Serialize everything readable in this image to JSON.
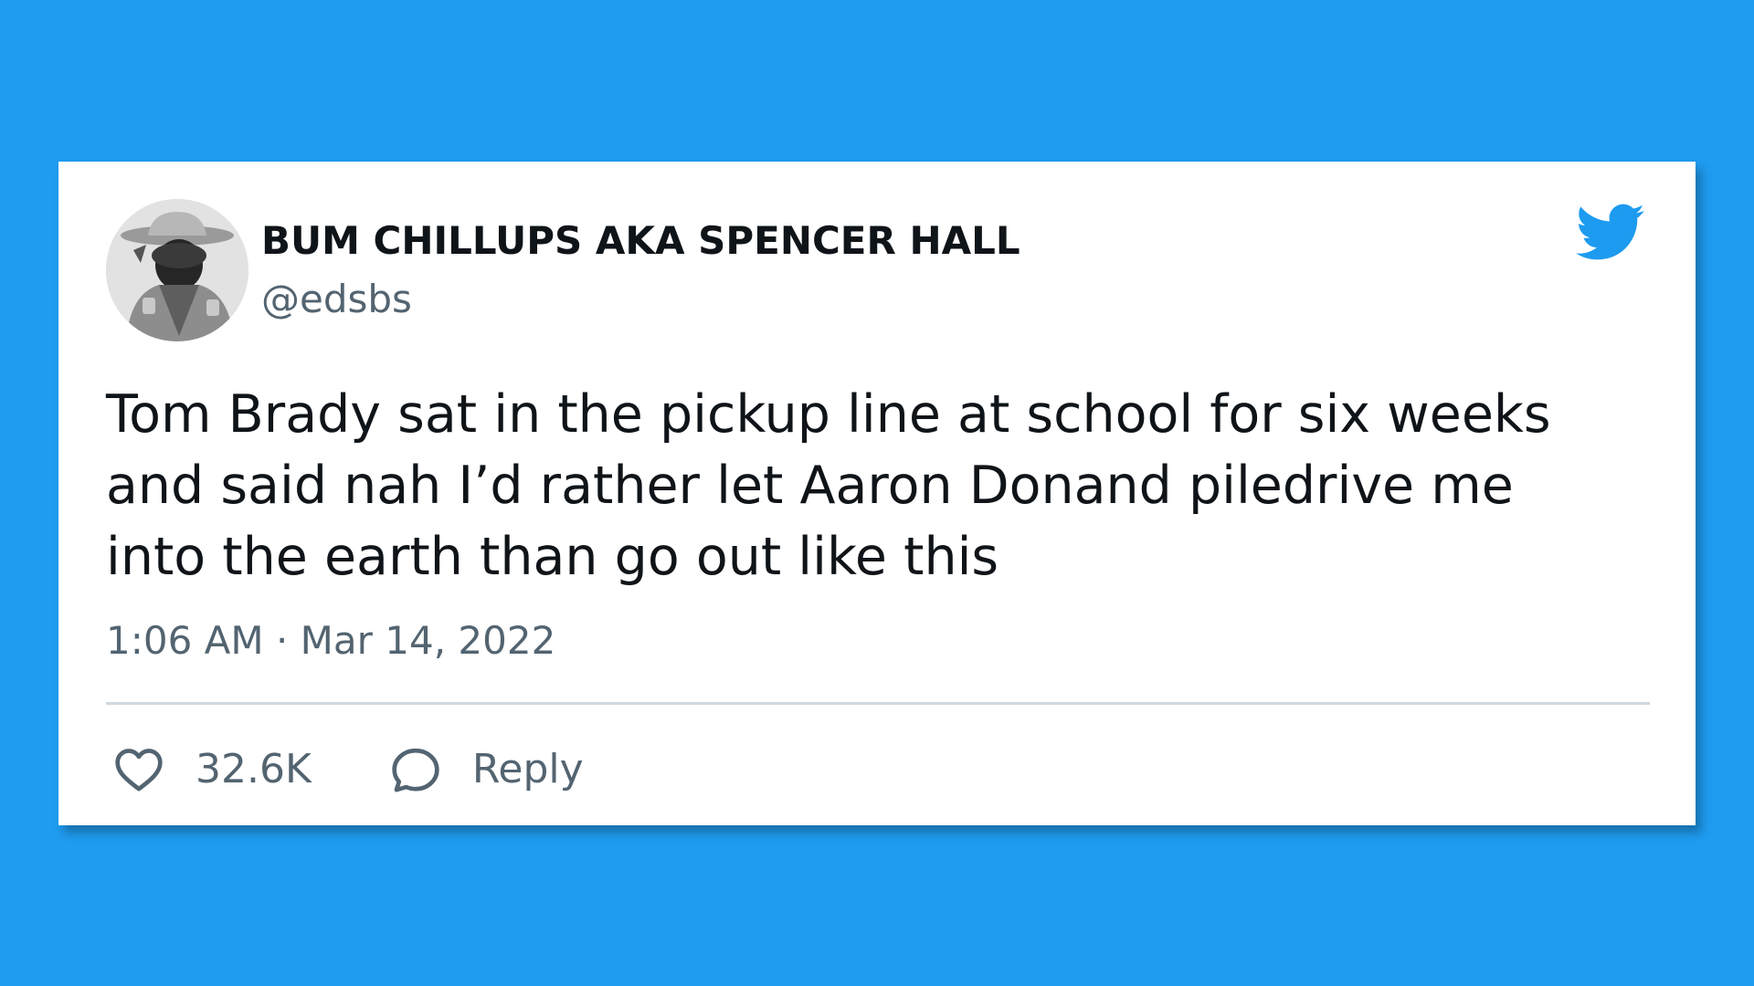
{
  "tweet": {
    "author": {
      "name": "BUM CHILLUPS AKA SPENCER HALL",
      "handle": "@edsbs"
    },
    "text_lines": [
      "Tom Brady sat in the pickup line at school for six weeks",
      "and said nah I’d rather let Aaron Donand piledrive me",
      "into the earth than go out like this"
    ],
    "timestamp": "1:06 AM · Mar 14, 2022",
    "likes": "32.6K",
    "reply_label": "Reply"
  },
  "icons": {
    "brand": "twitter-bird-icon",
    "like": "heart-icon",
    "reply": "speech-bubble-icon"
  },
  "colors": {
    "background": "#1f9bef",
    "card": "#ffffff",
    "text_primary": "#0f1419",
    "text_secondary": "#536471",
    "twitter_blue": "#1d9bf0",
    "divider": "#cfd9de"
  }
}
